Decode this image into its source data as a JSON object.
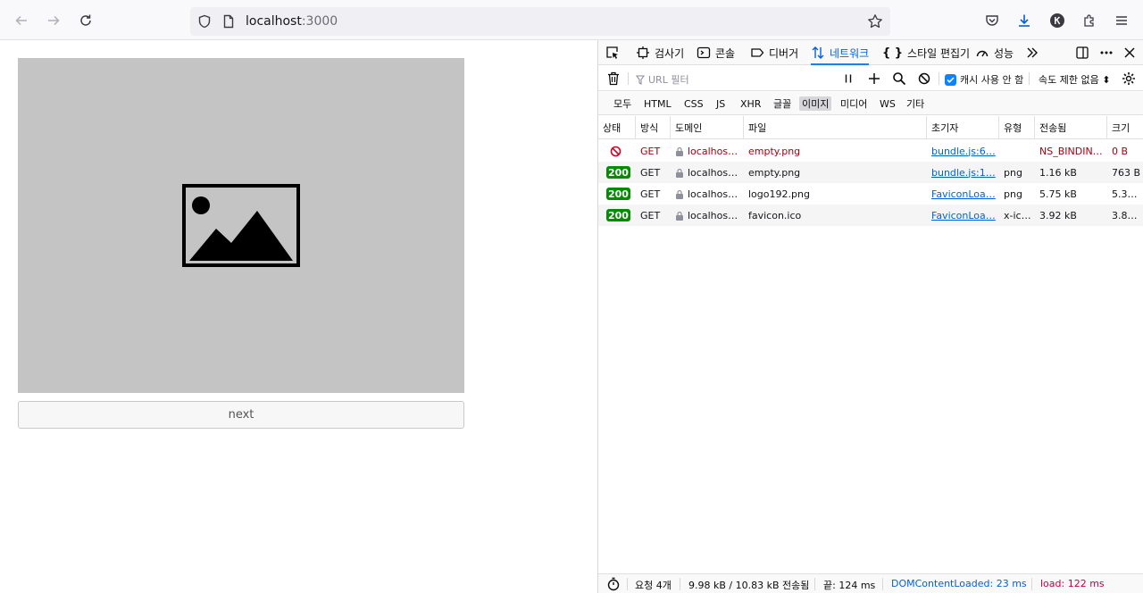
{
  "browser": {
    "url_host": "localhost",
    "url_port": ":3000"
  },
  "page": {
    "next_label": "next"
  },
  "devtools": {
    "tabs": [
      {
        "label": "검사기"
      },
      {
        "label": "콘솔"
      },
      {
        "label": "디버거"
      },
      {
        "label": "네트워크"
      },
      {
        "label": "스타일 편집기"
      },
      {
        "label": "성능"
      }
    ],
    "filter_placeholder": "URL 필터",
    "cache_label": "캐시 사용 안 함",
    "throttle_label": "속도 제한 없음 ⬍",
    "type_filters": [
      "모두",
      "HTML",
      "CSS",
      "JS",
      "XHR",
      "글꼴",
      "이미지",
      "미디어",
      "WS",
      "기타"
    ],
    "active_type": "이미지",
    "columns": [
      "상태",
      "방식",
      "도메인",
      "파일",
      "초기자",
      "유형",
      "전송됨",
      "크기"
    ],
    "rows": [
      {
        "status": "",
        "method": "GET",
        "domain": "localhos…",
        "file": "empty.png",
        "initiator": "bundle.js:6…",
        "type": "",
        "transferred": "NS_BINDIN…",
        "size": "0 B"
      },
      {
        "status": "200",
        "method": "GET",
        "domain": "localhos…",
        "file": "empty.png",
        "initiator": "bundle.js:1…",
        "type": "png",
        "transferred": "1.16 kB",
        "size": "763 B"
      },
      {
        "status": "200",
        "method": "GET",
        "domain": "localhos…",
        "file": "logo192.png",
        "initiator": "FaviconLoa…",
        "type": "png",
        "transferred": "5.75 kB",
        "size": "5.3…"
      },
      {
        "status": "200",
        "method": "GET",
        "domain": "localhos…",
        "file": "favicon.ico",
        "initiator": "FaviconLoa…",
        "type": "x-ic…",
        "transferred": "3.92 kB",
        "size": "3.8…"
      }
    ],
    "statusbar": {
      "requests": "요청 4개",
      "transferred": "9.98 kB / 10.83 kB 전송됨",
      "finish": "끝: 124 ms",
      "dcl": "DOMContentLoaded: 23 ms",
      "load": "load: 122 ms"
    }
  },
  "colors": {
    "accent": "#0a84ff",
    "status_ok": "#058b00",
    "error": "#a4000f"
  }
}
